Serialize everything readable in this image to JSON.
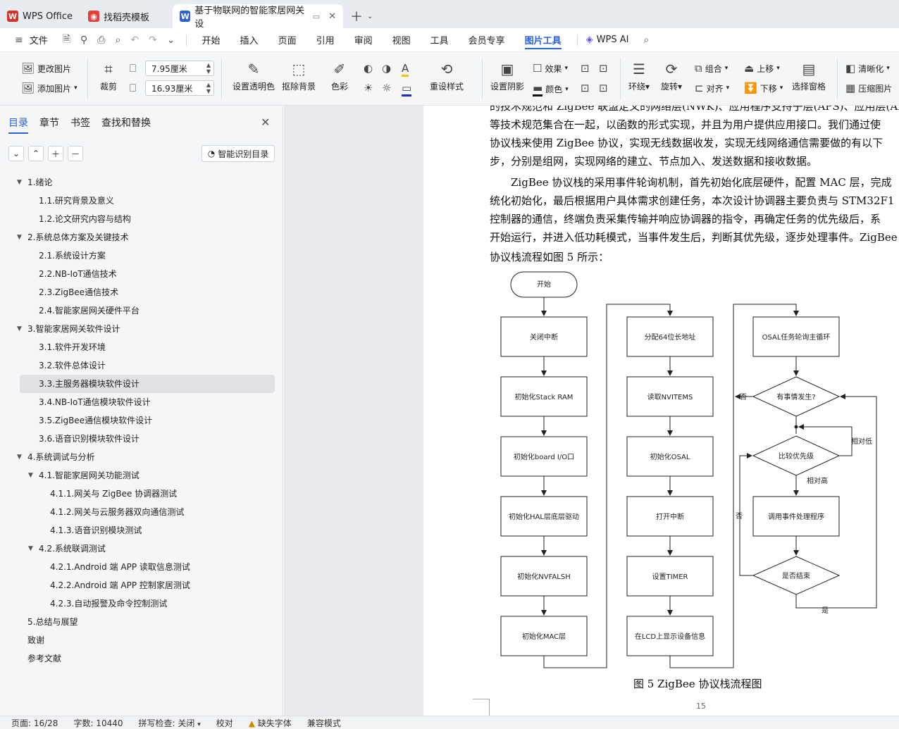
{
  "tabs": [
    {
      "label": "WPS Office",
      "icon": "wps-icon",
      "color": "#d7312b"
    },
    {
      "label": "找稻壳模板",
      "icon": "docer-icon",
      "color": "#e5403c"
    },
    {
      "label": "基于物联网的智能家居网关设",
      "icon": "writer-icon",
      "color": "#2b62d9"
    }
  ],
  "menu": {
    "file": "文件",
    "items": [
      "开始",
      "插入",
      "页面",
      "引用",
      "审阅",
      "视图",
      "工具",
      "会员专享",
      "图片工具"
    ],
    "active": "图片工具",
    "wps_ai": "WPS AI"
  },
  "ribbon": {
    "change_pic": "更改图片",
    "add_pic": "添加图片",
    "crop": "裁剪",
    "width": "7.95厘米",
    "height": "16.93厘米",
    "transparent": "设置透明色",
    "remove_bg": "抠除背景",
    "color": "色彩",
    "preset_style": "重设样式",
    "shadow": "设置阴影",
    "effect": "效果",
    "border_color": "颜色",
    "wrap": "环绕",
    "rotate": "旋转",
    "group": "组合",
    "align": "对齐",
    "up": "上移",
    "down": "下移",
    "select_pane": "选择窗格",
    "sharpen": "清晰化",
    "compress": "压缩图片"
  },
  "nav": {
    "tabs": [
      "目录",
      "章节",
      "书签",
      "查找和替换"
    ],
    "smart_toc": "智能识别目录",
    "toc": [
      {
        "label": "1.绪论",
        "level": 1,
        "toggle": true
      },
      {
        "label": "1.1.研究背景及意义",
        "level": 2
      },
      {
        "label": "1.2.论文研究内容与结构",
        "level": 2
      },
      {
        "label": "2.系统总体方案及关键技术",
        "level": 1,
        "toggle": true
      },
      {
        "label": "2.1.系统设计方案",
        "level": 2
      },
      {
        "label": "2.2.NB-IoT通信技术",
        "level": 2
      },
      {
        "label": "2.3.ZigBee通信技术",
        "level": 2
      },
      {
        "label": "2.4.智能家居网关硬件平台",
        "level": 2
      },
      {
        "label": "3.智能家居网关软件设计",
        "level": 1,
        "toggle": true
      },
      {
        "label": "3.1.软件开发环境",
        "level": 2
      },
      {
        "label": "3.2.软件总体设计",
        "level": 2
      },
      {
        "label": "3.3.主服务器模块软件设计",
        "level": 2,
        "selected": true
      },
      {
        "label": "3.4.NB-IoT通信模块软件设计",
        "level": 2
      },
      {
        "label": "3.5.ZigBee通信模块软件设计",
        "level": 2
      },
      {
        "label": "3.6.语音识别模块软件设计",
        "level": 2
      },
      {
        "label": "4.系统调试与分析",
        "level": 1,
        "toggle": true
      },
      {
        "label": "4.1.智能家居网关功能测试",
        "level": 2,
        "toggle": true
      },
      {
        "label": "4.1.1.网关与 ZigBee 协调器测试",
        "level": 3
      },
      {
        "label": "4.1.2.网关与云服务器双向通信测试",
        "level": 3
      },
      {
        "label": "4.1.3.语音识别模块测试",
        "level": 3
      },
      {
        "label": "4.2.系统联调测试",
        "level": 2,
        "toggle": true
      },
      {
        "label": "4.2.1.Android 端 APP 读取信息测试",
        "level": 3
      },
      {
        "label": "4.2.2.Android 端 APP 控制家居测试",
        "level": 3
      },
      {
        "label": "4.2.3.自动报警及命令控制测试",
        "level": 3
      },
      {
        "label": "5.总结与展望",
        "level": 1
      },
      {
        "label": "致谢",
        "level": 1
      },
      {
        "label": "参考文献",
        "level": 1
      }
    ]
  },
  "doc": {
    "lines": [
      "的技术规范和 ZigBee 联盟定义的网络层(NWK)、应用程序支持子层(APS)、应用层(AF)",
      "等技术规范集合在一起，以函数的形式实现，并且为用户提供应用接口。我们通过使",
      "协议栈来使用 ZigBee 协议，实现无线数据收发，实现无线网络通信需要做的有以下",
      "步，分别是组网，实现网络的建立、节点加入、发送数据和接收数据。",
      "ZigBee 协议栈的采用事件轮询机制，首先初始化底层硬件，配置 MAC 层，完成",
      "统化初始化，最后根据用户具体需求创建任务，本次设计协调器主要负责与 STM32F1",
      "控制器的通信，终端负责采集传输并响应协调器的指令，再确定任务的优先级后，系",
      "开始运行，并进入低功耗模式，当事件发生后，判断其优先级，逐步处理事件。ZigBee",
      "协议栈流程如图 5 所示："
    ],
    "caption": "图 5    ZigBee 协议栈流程图",
    "page_number": "15"
  },
  "flow": {
    "start": "开始",
    "col1": [
      "关闭中断",
      "初始化Stack RAM",
      "初始化board I/O口",
      "初始化HAL层底层驱动",
      "初始化NVFALSH",
      "初始化MAC层"
    ],
    "col2": [
      "分配64位长地址",
      "读取NVITEMS",
      "初始化OSAL",
      "打开中断",
      "设置TIMER",
      "在LCD上显示设备信息"
    ],
    "osal": "OSAL任务轮询主循环",
    "event": "有事情发生?",
    "compare": "比较优先级",
    "handler": "调用事件处理程序",
    "is_end": "是否结束",
    "no1": "否",
    "no2": "否",
    "low": "相对低",
    "high": "相对高",
    "yes": "是"
  },
  "status": {
    "page": "页面: 16/28",
    "words": "字数: 10440",
    "spell": "拼写检查: 关闭",
    "proof": "校对",
    "missing_font": "缺失字体",
    "compat": "兼容模式"
  }
}
